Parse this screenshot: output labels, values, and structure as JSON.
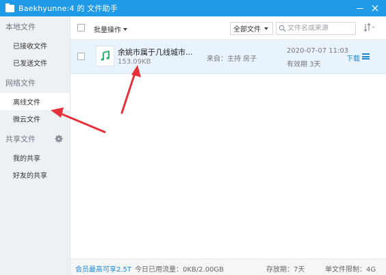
{
  "window": {
    "title": "Baekhyunne:4 的 文件助手",
    "title_color": "#1e9ae6"
  },
  "sidebar": {
    "sections": [
      {
        "label": "本地文件",
        "items": [
          {
            "label": "已接收文件"
          },
          {
            "label": "已发送文件"
          }
        ]
      },
      {
        "label": "网络文件",
        "items": [
          {
            "label": "离线文件",
            "active": true
          },
          {
            "label": "微云文件"
          }
        ]
      },
      {
        "label": "共享文件",
        "items": [
          {
            "label": "我的共享"
          },
          {
            "label": "好友的共享"
          }
        ]
      }
    ],
    "gear_icon": "gear-icon"
  },
  "toolbar": {
    "batch_label": "批量操作",
    "filter_value": "全部文件",
    "search_placeholder": "文件名或来源",
    "sort_icon": "sort-icon"
  },
  "files": [
    {
      "name": "余姚市属于几线城市...",
      "size": "153.09KB",
      "from": "来自：主持 房子",
      "date": "2020-07-07 11:03",
      "expire": "有效期 3天",
      "download_label": "下载",
      "icon": "music-note-icon"
    }
  ],
  "statusbar": {
    "member_link": "会员最高可享2.5T",
    "traffic": "今日已用流量：0KB/2.00GB",
    "storage_days": "存放期：7天",
    "single_limit": "单文件限制：4G"
  },
  "colors": {
    "accent": "#1e88d8",
    "annotation": "#e8303a",
    "selected_row": "#e8f3fd"
  }
}
